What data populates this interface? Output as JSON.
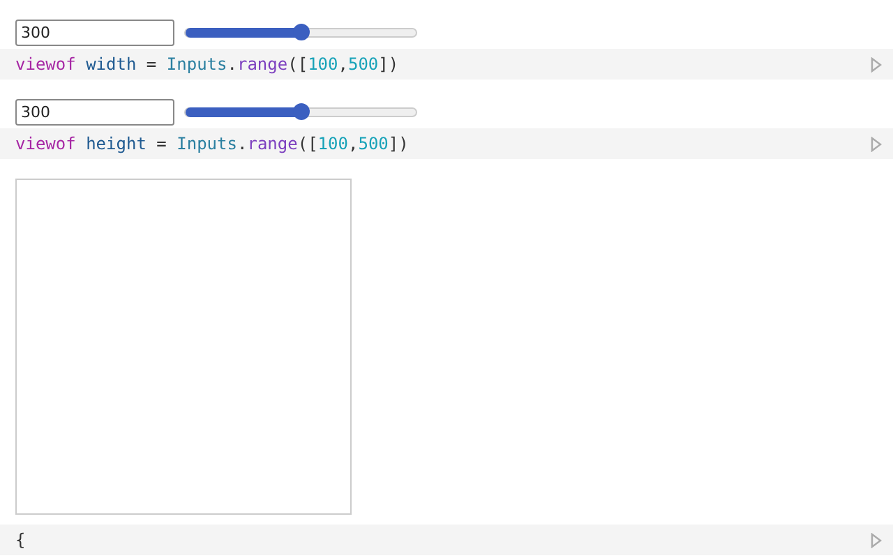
{
  "cells": [
    {
      "kind": "range",
      "input": {
        "value": "300",
        "level": 0.5
      },
      "code": [
        {
          "kind": "keyword",
          "text": "viewof "
        },
        {
          "kind": "variable",
          "text": "width"
        },
        {
          "kind": "plain",
          "text": " = "
        },
        {
          "kind": "object",
          "text": "Inputs"
        },
        {
          "kind": "plain",
          "text": "."
        },
        {
          "kind": "method",
          "text": "range"
        },
        {
          "kind": "plain",
          "text": "(["
        },
        {
          "kind": "number",
          "text": "100"
        },
        {
          "kind": "plain",
          "text": ","
        },
        {
          "kind": "number",
          "text": "500"
        },
        {
          "kind": "plain",
          "text": "])"
        }
      ]
    },
    {
      "kind": "range",
      "input": {
        "value": "300",
        "level": 0.5
      },
      "code": [
        {
          "kind": "keyword",
          "text": "viewof "
        },
        {
          "kind": "variable",
          "text": "height"
        },
        {
          "kind": "plain",
          "text": " = "
        },
        {
          "kind": "object",
          "text": "Inputs"
        },
        {
          "kind": "plain",
          "text": "."
        },
        {
          "kind": "method",
          "text": "range"
        },
        {
          "kind": "plain",
          "text": "(["
        },
        {
          "kind": "number",
          "text": "100"
        },
        {
          "kind": "plain",
          "text": ","
        },
        {
          "kind": "number",
          "text": "500"
        },
        {
          "kind": "plain",
          "text": "])"
        }
      ]
    },
    {
      "kind": "canvas"
    },
    {
      "kind": "code",
      "code": [
        {
          "kind": "plain",
          "text": "{"
        }
      ]
    }
  ]
}
